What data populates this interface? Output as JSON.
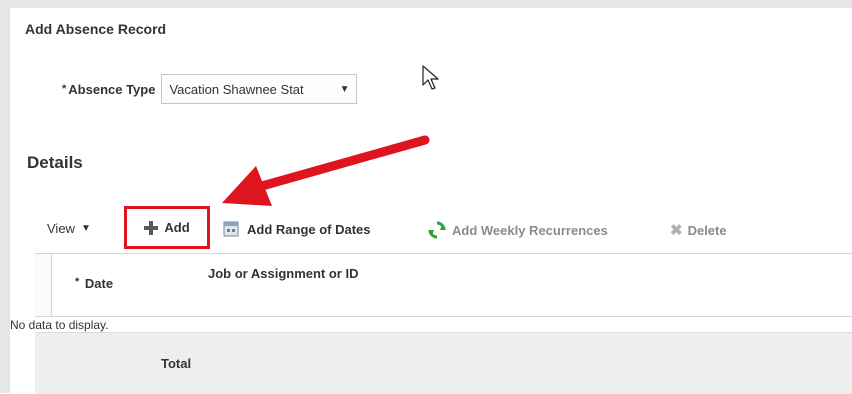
{
  "page": {
    "section_title": "Add Absence Record",
    "details_title": "Details"
  },
  "absence_type": {
    "required_mark": "*",
    "label": "Absence Type",
    "value": "Vacation Shawnee Stat"
  },
  "toolbar": {
    "view_label": "View",
    "add_label": "Add",
    "add_range_label": "Add Range of Dates",
    "add_weekly_label": "Add Weekly Recurrences",
    "delete_label": "Delete"
  },
  "table": {
    "date_required_mark": "*",
    "columns": [
      "Date",
      "Job or Assignment or ID"
    ],
    "empty_message": "No data to display.",
    "total_label": "Total"
  },
  "colors": {
    "highlight": "#e0141e",
    "disabled_text": "#8c8c8c",
    "refresh_icon": "#2da33b"
  },
  "icons": [
    "cursor-pointer-icon",
    "plus-icon",
    "calendar-icon",
    "refresh-icon",
    "delete-x-icon",
    "red-arrow-annotation"
  ]
}
